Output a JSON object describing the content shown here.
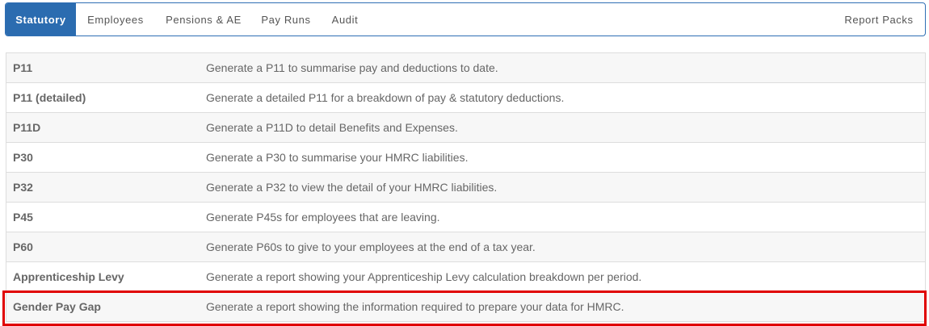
{
  "tabs": {
    "statutory": "Statutory",
    "employees": "Employees",
    "pensions": "Pensions & AE",
    "payruns": "Pay Runs",
    "audit": "Audit",
    "report_packs": "Report Packs"
  },
  "reports": [
    {
      "name": "P11",
      "description": "Generate a P11 to summarise pay and deductions to date."
    },
    {
      "name": "P11 (detailed)",
      "description": "Generate a detailed P11 for a breakdown of pay & statutory deductions."
    },
    {
      "name": "P11D",
      "description": "Generate a P11D to detail Benefits and Expenses."
    },
    {
      "name": "P30",
      "description": "Generate a P30 to summarise your HMRC liabilities."
    },
    {
      "name": "P32",
      "description": "Generate a P32 to view the detail of your HMRC liabilities."
    },
    {
      "name": "P45",
      "description": "Generate P45s for employees that are leaving."
    },
    {
      "name": "P60",
      "description": "Generate P60s to give to your employees at the end of a tax year."
    },
    {
      "name": "Apprenticeship Levy",
      "description": "Generate a report showing your Apprenticeship Levy calculation breakdown per period."
    },
    {
      "name": "Gender Pay Gap",
      "description": "Generate a report showing the information required to prepare your data for HMRC."
    }
  ],
  "colors": {
    "active_tab": "#2b6cb0",
    "highlight": "#e00000"
  }
}
